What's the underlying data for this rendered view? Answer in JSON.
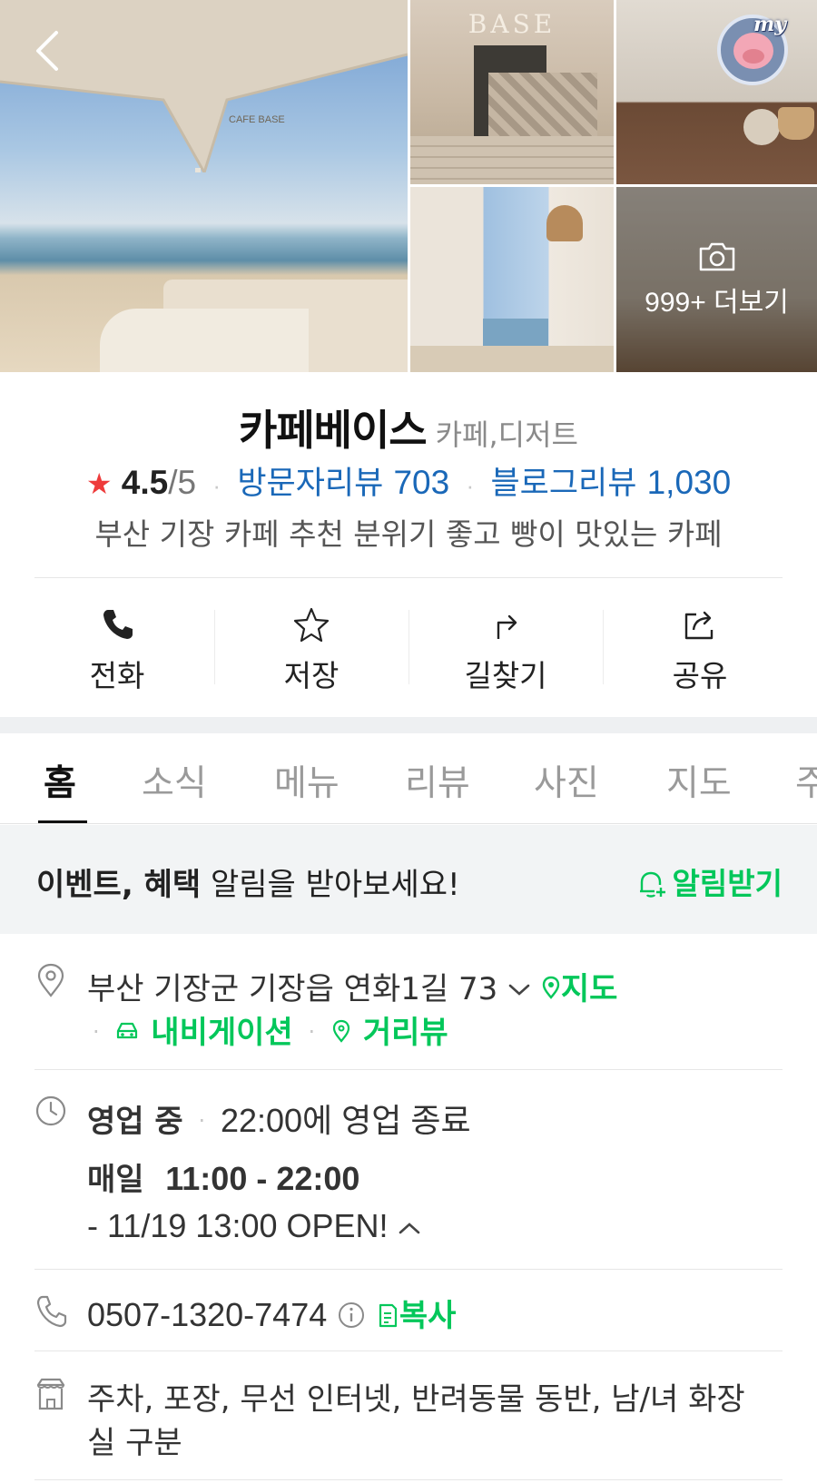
{
  "gallery": {
    "main_photo_label": "CAFE BASE",
    "sign_label": "BASE",
    "more_photos_label": "999+ 더보기",
    "avatar_badge": "my"
  },
  "place": {
    "name": "카페베이스",
    "category": "카페,디저트",
    "rating": "4.5",
    "rating_max": "/5",
    "visitor_review_label": "방문자리뷰",
    "visitor_review_count": "703",
    "blog_review_label": "블로그리뷰",
    "blog_review_count": "1,030",
    "description": "부산 기장 카페 추천 분위기 좋고 빵이 맛있는 카페"
  },
  "actions": [
    {
      "label": "전화",
      "icon": "phone-icon"
    },
    {
      "label": "저장",
      "icon": "star-icon"
    },
    {
      "label": "길찾기",
      "icon": "directions-icon"
    },
    {
      "label": "공유",
      "icon": "share-icon"
    }
  ],
  "tabs": [
    "홈",
    "소식",
    "메뉴",
    "리뷰",
    "사진",
    "지도",
    "주"
  ],
  "active_tab": "홈",
  "notice": {
    "bold_text": "이벤트, 혜택",
    "text": " 알림을 받아보세요!",
    "button_label": "알림받기"
  },
  "address": {
    "text": "부산 기장군 기장읍 연화1길 73",
    "map_link": "지도",
    "navigation_link": "내비게이션",
    "streetview_link": "거리뷰"
  },
  "hours": {
    "status": "영업 중",
    "close_text": "22:00에 영업 종료",
    "days": "매일",
    "time_range": "11:00 - 22:00",
    "note": "- 11/19 13:00 OPEN!"
  },
  "phone": {
    "number": "0507-1320-7474",
    "copy_label": "복사"
  },
  "amenities": {
    "line1": "주차, 포장, 무선 인터넷, 반려동물 동반, 남/녀 화장",
    "line2": "실 구분"
  },
  "colors": {
    "accent_green": "#03c75a",
    "link_blue": "#1a68b8",
    "star_red": "#ee3b3b"
  }
}
